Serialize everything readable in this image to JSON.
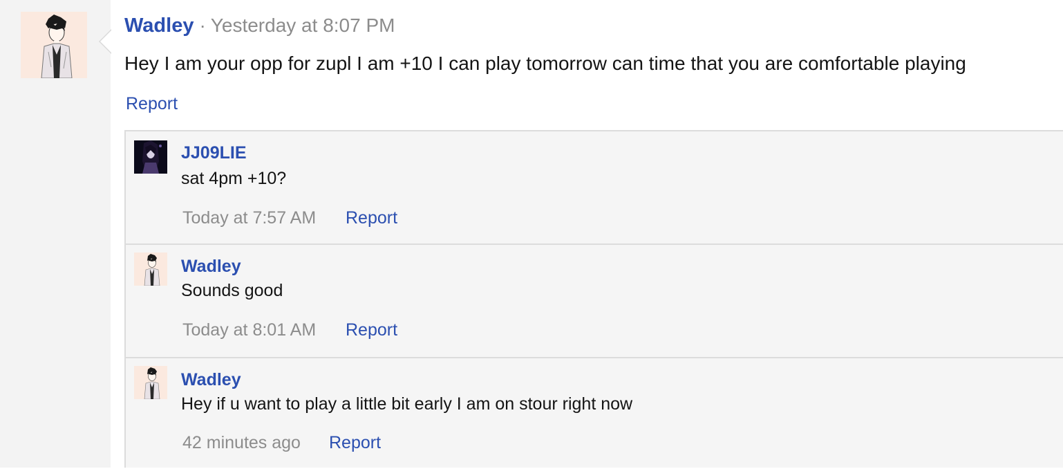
{
  "message": {
    "author": "Wadley",
    "separator": "·",
    "date": "Yesterday at 8:07 PM",
    "body": "Hey I am your opp for zupl I am +10 I can play tomorrow can time that you are comfortable playing",
    "report_label": "Report",
    "avatar_icon": "anime-character-avatar-icon"
  },
  "comments": [
    {
      "author": "JJ09LIE",
      "text": "sat 4pm +10?",
      "date": "Today at 7:57 AM",
      "report_label": "Report",
      "avatar_icon": "dark-anime-avatar-icon"
    },
    {
      "author": "Wadley",
      "text": "Sounds good",
      "date": "Today at 8:01 AM",
      "report_label": "Report",
      "avatar_icon": "anime-character-avatar-icon"
    },
    {
      "author": "Wadley",
      "text": "Hey if u want to play a little bit early I am on stour right now",
      "date": "42 minutes ago",
      "report_label": "Report",
      "avatar_icon": "anime-character-avatar-icon"
    }
  ],
  "colors": {
    "link": "#2b4fb0",
    "meta": "#8c8c8c",
    "rail": "#f3f3f3",
    "comment_bg": "#f5f5f5"
  }
}
